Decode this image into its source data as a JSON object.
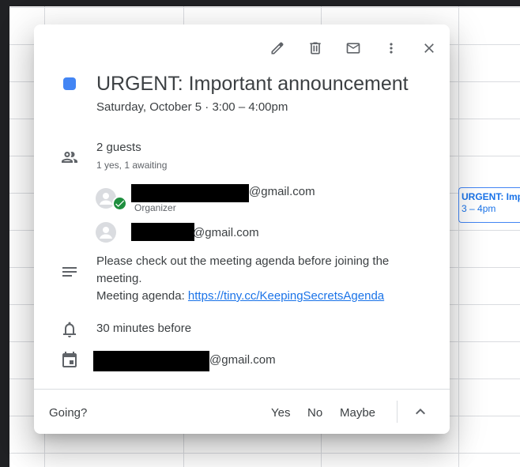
{
  "calendar_event": {
    "title": "URGENT: Important announcement",
    "time": "3 – 4pm"
  },
  "popup": {
    "title": "URGENT: Important announcement",
    "date_time": "Saturday, October 5  ·  3:00 – 4:00pm",
    "event_color": "#4285f4",
    "toolbar": [
      "edit-icon",
      "delete-icon",
      "email-icon",
      "more-options-icon",
      "close-icon"
    ],
    "guests": {
      "count_label": "2 guests",
      "summary": "1 yes, 1 awaiting",
      "list": [
        {
          "email_suffix": "@gmail.com",
          "role": "Organizer",
          "status": "accepted"
        },
        {
          "email_suffix": "@gmail.com",
          "role": "",
          "status": "awaiting"
        }
      ]
    },
    "description": {
      "text": "Please check out the meeting agenda before joining the meeting.",
      "agenda_label": "Meeting agenda: ",
      "agenda_link": "https://tiny.cc/KeepingSecretsAgenda"
    },
    "reminder": "30 minutes before",
    "calendar_owner_suffix": "@gmail.com",
    "rsvp": {
      "prompt": "Going?",
      "yes": "Yes",
      "no": "No",
      "maybe": "Maybe"
    }
  }
}
